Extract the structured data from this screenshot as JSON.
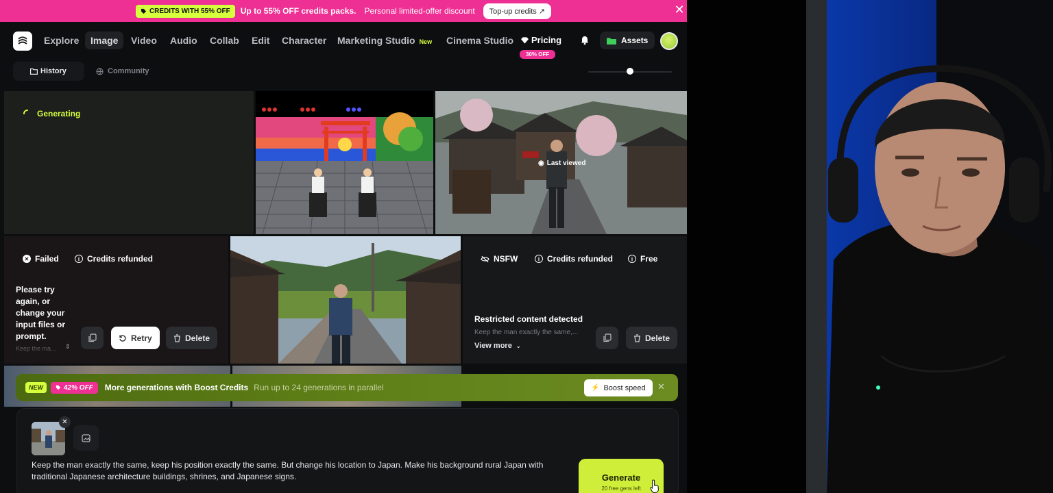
{
  "promo": {
    "badge": "CREDITS WITH 55% OFF",
    "headline": "Up to 55% OFF credits packs.",
    "subline": "Personal limited-offer discount",
    "topup_label": "Top-up credits",
    "close_icon": "close-icon"
  },
  "nav": {
    "items": [
      "Explore",
      "Image",
      "Video",
      "Audio",
      "Collab",
      "Edit",
      "Character",
      "Marketing Studio",
      "Cinema Studio"
    ],
    "active": "Image",
    "new_tag": "New",
    "pricing_label": "Pricing",
    "pricing_badge": "30% OFF",
    "assets_label": "Assets"
  },
  "subtabs": {
    "history": "History",
    "community": "Community",
    "active": "History"
  },
  "grid": {
    "generating_label": "Generating",
    "last_viewed_label": "Last viewed",
    "failed_card": {
      "status": "Failed",
      "refund": "Credits refunded",
      "message": "Please try again, or change your input files or prompt.",
      "truncated_prompt": "Keep the ma...",
      "retry_label": "Retry",
      "delete_label": "Delete"
    },
    "nsfw_card": {
      "status": "NSFW",
      "refund": "Credits refunded",
      "free": "Free",
      "title": "Restricted content detected",
      "prompt_preview": "Keep the man exactly the same,...",
      "view_more": "View more",
      "delete_label": "Delete"
    }
  },
  "boost": {
    "new_tag": "NEW",
    "discount": "42% OFF",
    "title": "More generations with Boost Credits",
    "description": "Run up to 24 generations in parallel",
    "button": "Boost speed"
  },
  "composer": {
    "prompt": "Keep the man exactly the same, keep his position exactly the same. But change his location to Japan. Make his background rural Japan with traditional Japanese architecture buildings, shrines, and Japanese signs.",
    "generate_label": "Generate",
    "generate_sub": "20 free gens left"
  },
  "colors": {
    "accent": "#d6ff3d",
    "promo_bg": "#ee2f93",
    "app_bg": "#0d0e10"
  }
}
